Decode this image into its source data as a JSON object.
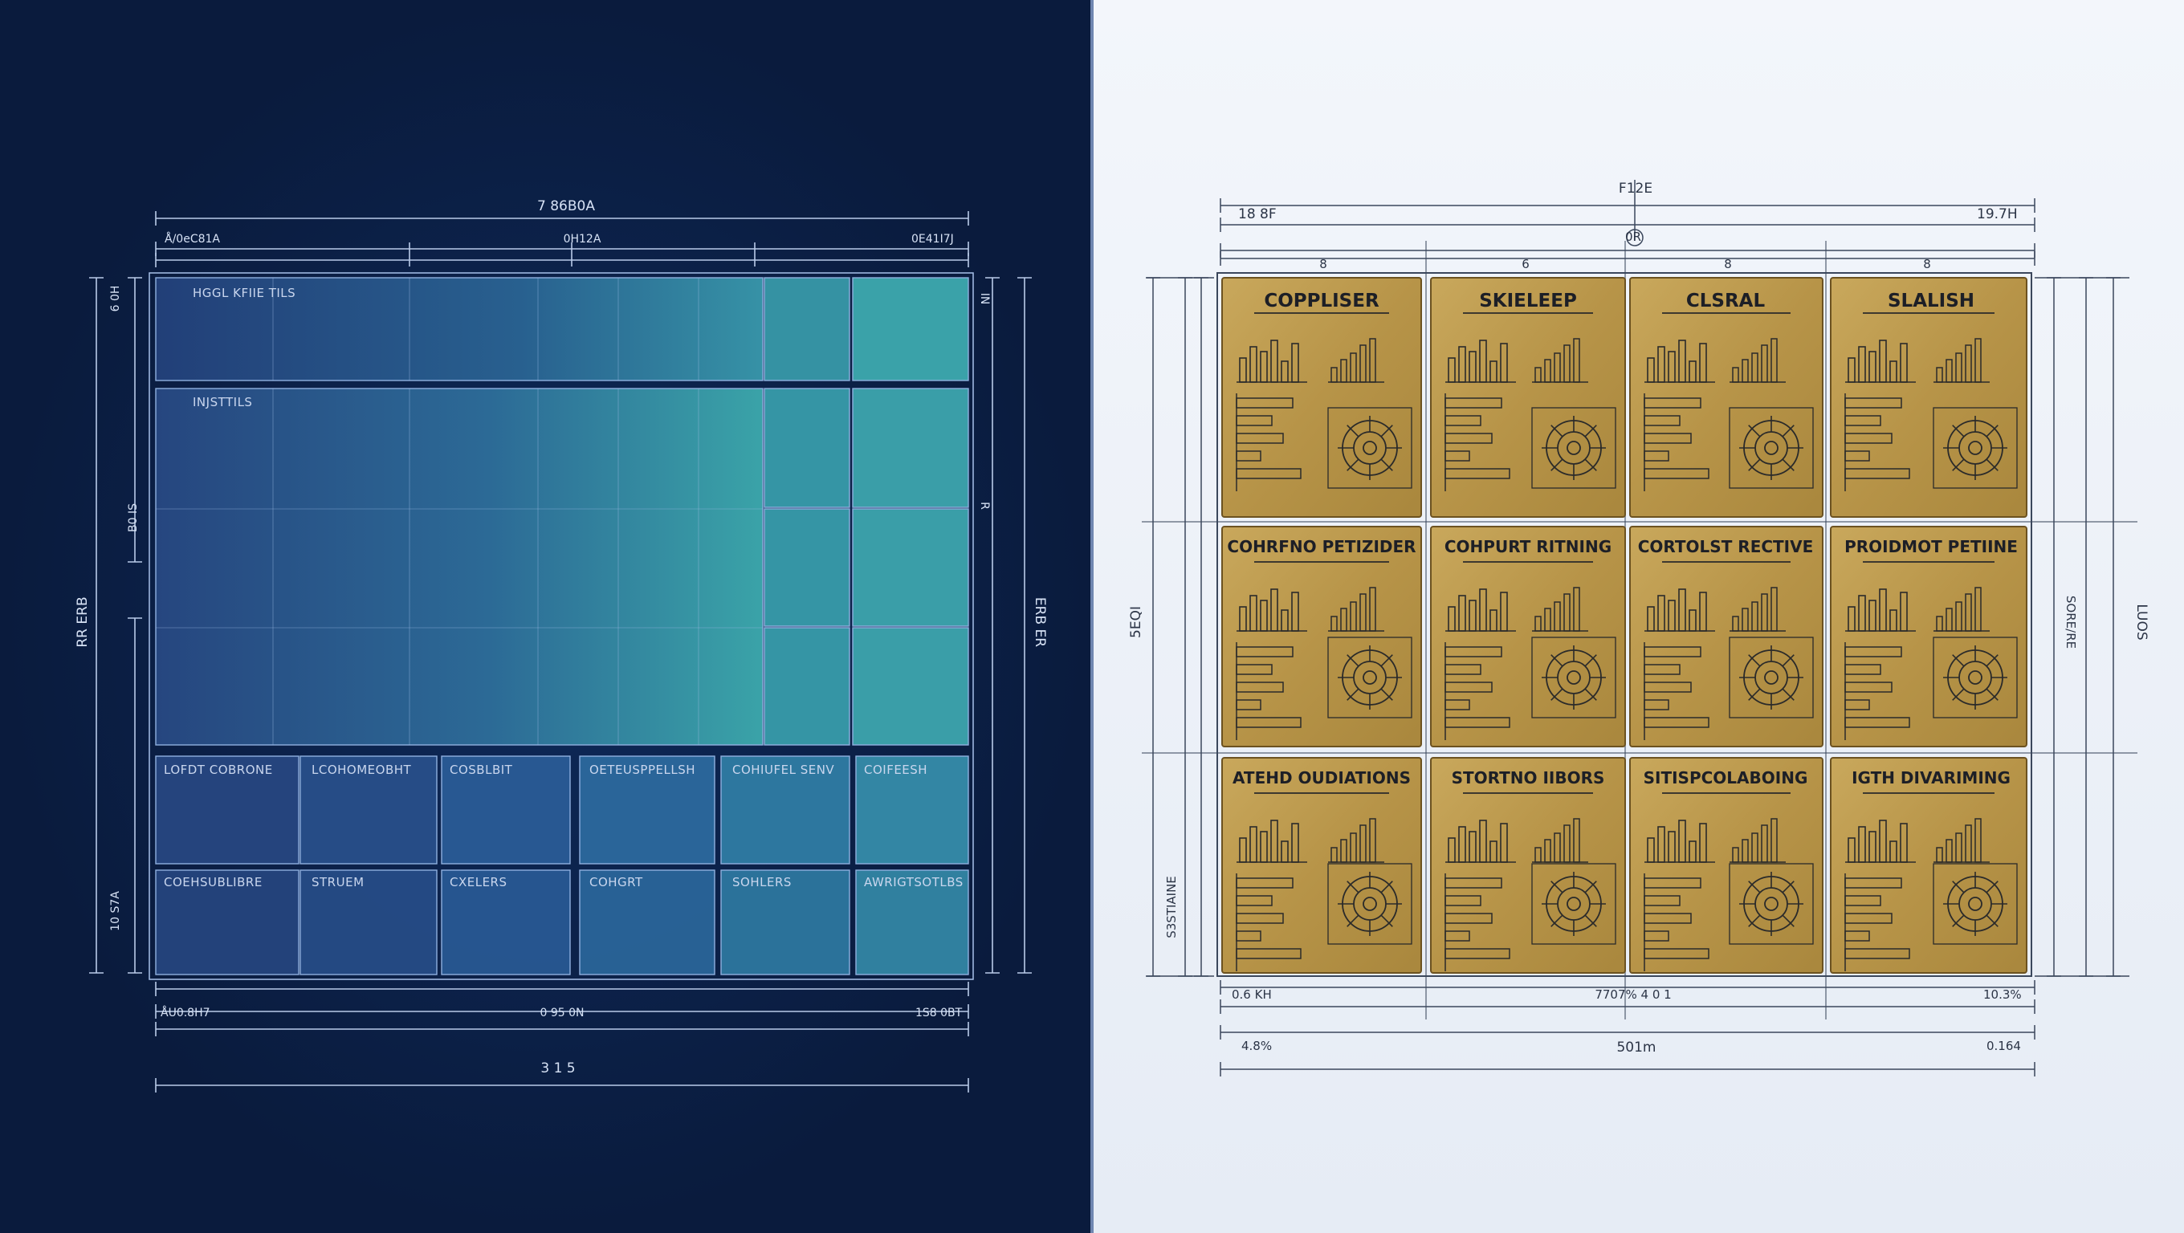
{
  "left_panel": {
    "dims": {
      "top_total": "7 86B0A",
      "top_left": "Å/0eC81A",
      "top_mid": "0H12A",
      "top_right": "0E41I7J",
      "left_outer": "RR ERB",
      "left_inner_top": "6 0H",
      "left_inner_mid": "B0 IS",
      "left_inner_bottom": "10 S7A",
      "right_outer": "ERB ER",
      "right_inner_top": "IN",
      "right_inner_mid": "R",
      "bottom_left": "ÅU0.8H7",
      "bottom_mid": "0 95 0N",
      "bottom_right": "1S8 0BT",
      "bottom_total": "3 1 5"
    },
    "hero_labels": [
      "HGGL KFIIE TILS",
      "INJSTTILS"
    ],
    "row1": [
      "LOFDT COBRONE",
      "LCOHOMEOBHT",
      "COSBLBIT",
      "OETEUSPPELLSH",
      "COHIUFEL SENV",
      "COIFEESH"
    ],
    "row2": [
      "COEHSUBLIBRE",
      "STRUEM",
      "CXELERS",
      "COHGRT",
      "SOHLERS",
      "AWRIGTSOTLBS"
    ],
    "colors": {
      "tile_start": "#2a4e8e",
      "tile_end": "#3aa0a8",
      "line": "#a7c1ea"
    }
  },
  "right_panel": {
    "dims": {
      "top_marker": "F12E",
      "top_left": "18 8F",
      "top_right": "19.7H",
      "top_center": "0R",
      "col_labels": [
        "8",
        "6",
        "8",
        "8"
      ],
      "left_outer": "5EQI",
      "left_inner": "S3STIAINE",
      "right_outer": "LUOS",
      "right_inner": "SORE/RE",
      "bottom_left": "0.6 KH",
      "bottom_mid": "7707% 4 0 1",
      "bottom_right": "10.3%",
      "bottom_sub_left": "4.8%",
      "bottom_total": "501m",
      "bottom_sub_right": "0.164"
    },
    "plaques": [
      "COPPLISER",
      "SKIELEEP",
      "CLSRAL",
      "SLALISH",
      "COHRFNO PETIZIDER",
      "COHPURT RITNING",
      "CORTOLST RECTIVE",
      "PROIDMOT PETIINE",
      "ATEHD OUDIATIONS",
      "STORTNO IIBORS",
      "SITISPCOLABOING",
      "IGTH DIVARIMING"
    ],
    "colors": {
      "plaque": "#b8974c",
      "plaque_dark": "#a5823b",
      "ink": "#2a2a2a",
      "frame": "#3b475c"
    }
  }
}
